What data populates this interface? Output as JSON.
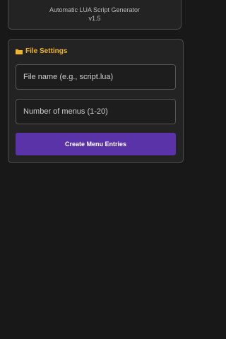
{
  "header": {
    "subtitle": "Automatic LUA Script Generator",
    "version": "v1.5"
  },
  "file_settings": {
    "title": "File Settings",
    "icon": "folder-icon",
    "filename_placeholder": "File name (e.g., script.lua)",
    "menus_placeholder": "Number of menus (1-20)",
    "button_label": "Create Menu Entries"
  },
  "colors": {
    "background": "#181818",
    "card": "#232323",
    "accent_title": "#f0b429",
    "button": "#5b33a8"
  }
}
